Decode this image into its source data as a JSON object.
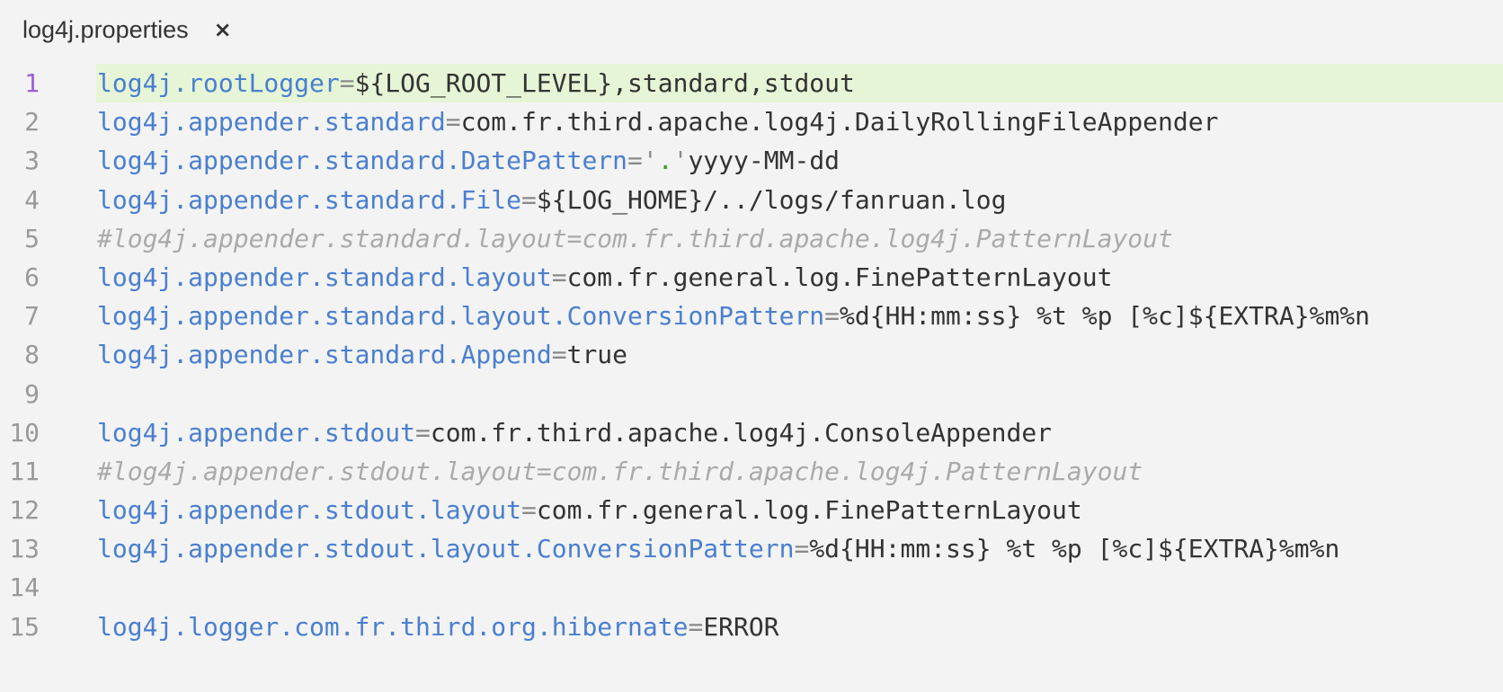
{
  "tab": {
    "title": "log4j.properties",
    "close_icon": "×"
  },
  "editor": {
    "active_line": 1,
    "lines": [
      {
        "n": "1",
        "segs": [
          [
            "k",
            "log4j.rootLogger"
          ],
          [
            "e",
            "="
          ],
          [
            "v",
            "${LOG_ROOT_LEVEL},standard,stdout"
          ]
        ]
      },
      {
        "n": "2",
        "segs": [
          [
            "k",
            "log4j.appender.standard"
          ],
          [
            "e",
            "="
          ],
          [
            "v",
            "com.fr.third.apache.log4j.DailyRollingFileAppender"
          ]
        ]
      },
      {
        "n": "3",
        "segs": [
          [
            "k",
            "log4j.appender.standard.DatePattern"
          ],
          [
            "e",
            "='"
          ],
          [
            "g",
            "."
          ],
          [
            "e",
            "'"
          ],
          [
            "v",
            "yyyy-MM-dd"
          ]
        ]
      },
      {
        "n": "4",
        "segs": [
          [
            "k",
            "log4j.appender.standard.File"
          ],
          [
            "e",
            "="
          ],
          [
            "v",
            "${LOG_HOME}/../logs/fanruan.log"
          ]
        ]
      },
      {
        "n": "5",
        "segs": [
          [
            "c",
            "#log4j.appender.standard.layout=com.fr.third.apache.log4j.PatternLayout"
          ]
        ]
      },
      {
        "n": "6",
        "segs": [
          [
            "k",
            "log4j.appender.standard.layout"
          ],
          [
            "e",
            "="
          ],
          [
            "v",
            "com.fr.general.log.FinePatternLayout"
          ]
        ]
      },
      {
        "n": "7",
        "segs": [
          [
            "k",
            "log4j.appender.standard.layout.ConversionPattern"
          ],
          [
            "e",
            "="
          ],
          [
            "v",
            "%d{HH:mm:ss} %t %p [%c]${EXTRA}%m%n"
          ]
        ]
      },
      {
        "n": "8",
        "segs": [
          [
            "k",
            "log4j.appender.standard.Append"
          ],
          [
            "e",
            "="
          ],
          [
            "v",
            "true"
          ]
        ]
      },
      {
        "n": "9",
        "segs": []
      },
      {
        "n": "10",
        "segs": [
          [
            "k",
            "log4j.appender.stdout"
          ],
          [
            "e",
            "="
          ],
          [
            "v",
            "com.fr.third.apache.log4j.ConsoleAppender"
          ]
        ]
      },
      {
        "n": "11",
        "segs": [
          [
            "c",
            "#log4j.appender.stdout.layout=com.fr.third.apache.log4j.PatternLayout"
          ]
        ]
      },
      {
        "n": "12",
        "segs": [
          [
            "k",
            "log4j.appender.stdout.layout"
          ],
          [
            "e",
            "="
          ],
          [
            "v",
            "com.fr.general.log.FinePatternLayout"
          ]
        ]
      },
      {
        "n": "13",
        "segs": [
          [
            "k",
            "log4j.appender.stdout.layout.ConversionPattern"
          ],
          [
            "e",
            "="
          ],
          [
            "v",
            "%d{HH:mm:ss} %t %p [%c]${EXTRA}%m%n"
          ]
        ]
      },
      {
        "n": "14",
        "segs": []
      },
      {
        "n": "15",
        "segs": [
          [
            "k",
            "log4j.logger.com.fr.third.org.hibernate"
          ],
          [
            "e",
            "="
          ],
          [
            "v",
            "ERROR"
          ]
        ]
      }
    ]
  }
}
